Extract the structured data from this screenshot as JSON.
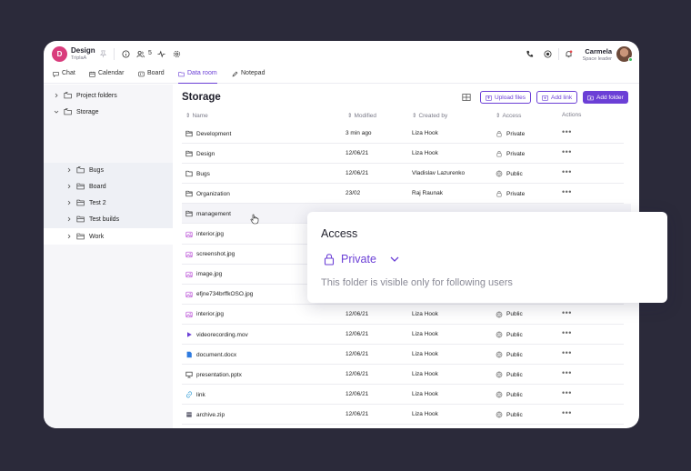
{
  "header": {
    "workspace_initial": "D",
    "workspace_name": "Design",
    "workspace_sub": "TriplaA",
    "members_count": "5",
    "user_name": "Carmela",
    "user_role": "Space leader"
  },
  "tabs": [
    {
      "label": "Chat",
      "icon": "chat-icon"
    },
    {
      "label": "Calendar",
      "icon": "calendar-icon"
    },
    {
      "label": "Board",
      "icon": "board-icon"
    },
    {
      "label": "Data room",
      "icon": "folder-icon",
      "active": true
    },
    {
      "label": "Notepad",
      "icon": "pen-icon"
    }
  ],
  "sidebar": {
    "items": [
      {
        "label": "Project folders",
        "expanded": false
      },
      {
        "label": "Storage",
        "expanded": true
      },
      {
        "label": "Bugs"
      },
      {
        "label": "Board"
      },
      {
        "label": "Test 2"
      },
      {
        "label": "Test builds"
      },
      {
        "label": "Work"
      }
    ]
  },
  "main": {
    "title": "Storage",
    "buttons": {
      "upload": "Upload files",
      "add_link": "Add link",
      "add_folder": "Add folder"
    },
    "columns": {
      "name": "Name",
      "modified": "Modified",
      "created_by": "Created by",
      "access": "Access",
      "actions": "Actions"
    },
    "rows": [
      {
        "name": "Development",
        "type": "folder",
        "modified": "3 min ago",
        "created_by": "Liza Hook",
        "access": "Private"
      },
      {
        "name": "Design",
        "type": "folder",
        "modified": "12/06/21",
        "created_by": "Liza Hook",
        "access": "Private"
      },
      {
        "name": "Bugs",
        "type": "folder-open",
        "modified": "12/06/21",
        "created_by": "Vladislav Lazurenko",
        "access": "Public"
      },
      {
        "name": "Organization",
        "type": "folder",
        "modified": "23/02",
        "created_by": "Raj Raunak",
        "access": "Private"
      },
      {
        "name": "management",
        "type": "folder",
        "modified": "",
        "created_by": "",
        "access": ""
      },
      {
        "name": "interior.jpg",
        "type": "image",
        "modified": "",
        "created_by": "",
        "access": ""
      },
      {
        "name": "screenshot.jpg",
        "type": "image",
        "modified": "",
        "created_by": "",
        "access": ""
      },
      {
        "name": "image.jpg",
        "type": "image",
        "modified": "",
        "created_by": "",
        "access": ""
      },
      {
        "name": "efjne734brffkOSO.jpg",
        "type": "image",
        "modified": "",
        "created_by": "",
        "access": ""
      },
      {
        "name": "interior.jpg",
        "type": "image",
        "modified": "12/06/21",
        "created_by": "Liza Hook",
        "access": "Public"
      },
      {
        "name": "videorecording.mov",
        "type": "video",
        "modified": "12/06/21",
        "created_by": "Liza Hook",
        "access": "Public"
      },
      {
        "name": "document.docx",
        "type": "doc",
        "modified": "12/06/21",
        "created_by": "Liza Hook",
        "access": "Public"
      },
      {
        "name": "presentation.pptx",
        "type": "presentation",
        "modified": "12/06/21",
        "created_by": "Liza Hook",
        "access": "Public"
      },
      {
        "name": "link",
        "type": "link",
        "modified": "12/06/21",
        "created_by": "Liza Hook",
        "access": "Public"
      },
      {
        "name": "archive.zip",
        "type": "archive",
        "modified": "12/06/21",
        "created_by": "Liza Hook",
        "access": "Public"
      }
    ],
    "actions_label": "•••"
  },
  "popup": {
    "title": "Access",
    "value": "Private",
    "description": "This folder is visible only for following users"
  },
  "colors": {
    "accent": "#6b3fd6",
    "workspace": "#d93c7c",
    "background": "#2b2a3a",
    "image_icon": "#b84fd6",
    "doc_icon": "#2f7be0",
    "link_icon": "#3aa0d8"
  }
}
